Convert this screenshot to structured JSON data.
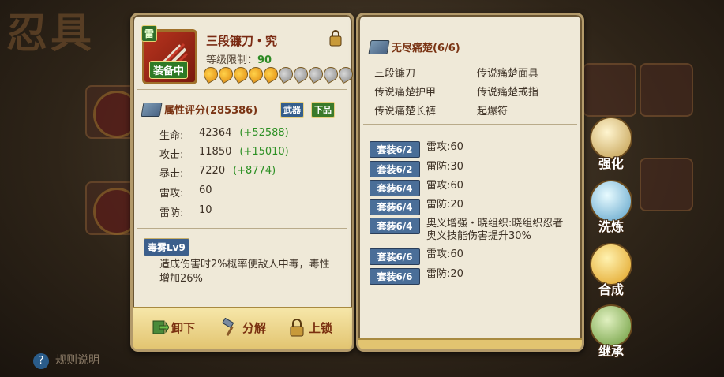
{
  "background": {
    "title": "忍具",
    "rules_label": "规则说明"
  },
  "item": {
    "type_badge": "雷",
    "equipped_label": "装备中",
    "name": "三段镰刀・究",
    "level_label": "等级限制：",
    "level_value": "90",
    "stars_total": 10,
    "stars_filled": 5
  },
  "attributes": {
    "header": "属性评分(285386)",
    "tag_weapon": "武器",
    "tag_grade": "下品",
    "stats": [
      {
        "label": "生命:",
        "value": "42364",
        "bonus": "(+52588)"
      },
      {
        "label": "攻击:",
        "value": "11850",
        "bonus": "(+15010)"
      },
      {
        "label": "暴击:",
        "value": "7220",
        "bonus": "(+8774)"
      },
      {
        "label": "雷攻:",
        "value": "60",
        "bonus": ""
      },
      {
        "label": "雷防:",
        "value": "10",
        "bonus": ""
      }
    ]
  },
  "skill": {
    "name": "毒雾Lv9",
    "description": "造成伤害时2%概率使敌人中毒，毒性增加26%"
  },
  "actions_left": {
    "unequip": "卸下",
    "decompose": "分解",
    "lock": "上锁"
  },
  "set": {
    "title": "无尽痛楚(6/6)",
    "items": [
      "三段镰刀",
      "传说痛楚面具",
      "传说痛楚护甲",
      "传说痛楚戒指",
      "传说痛楚长裤",
      "起爆符"
    ],
    "bonuses": [
      {
        "tag": "套装6/2",
        "text": "雷攻:60"
      },
      {
        "tag": "套装6/2",
        "text": "雷防:30"
      },
      {
        "tag": "套装6/4",
        "text": "雷攻:60"
      },
      {
        "tag": "套装6/4",
        "text": "雷防:20"
      },
      {
        "tag": "套装6/4",
        "text": "奥义增强・晓组织:晓组织忍者奥义技能伤害提升30%"
      },
      {
        "tag": "套装6/6",
        "text": "雷攻:60"
      },
      {
        "tag": "套装6/6",
        "text": "雷防:20"
      }
    ]
  },
  "side_actions": {
    "strengthen": "强化",
    "refine": "洗炼",
    "synthesize": "合成",
    "inherit": "继承"
  },
  "colors": {
    "panel_bg": "#efe9d8",
    "bonus_green": "#2d9024",
    "title_brown": "#7a2a12",
    "tag_blue": "#4a6e98"
  }
}
